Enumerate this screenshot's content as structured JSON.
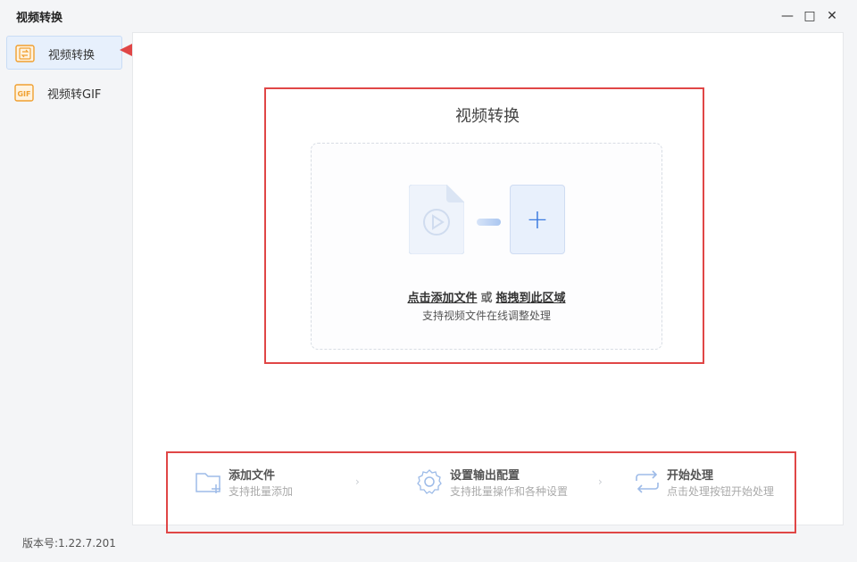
{
  "window": {
    "title": "视频转换",
    "minimize_label": "—",
    "maximize_label": "□",
    "close_label": "✕"
  },
  "sidebar": {
    "items": [
      {
        "label": "视频转换",
        "icon": "video-convert-icon",
        "active": true
      },
      {
        "label": "视频转GIF",
        "icon": "gif-icon",
        "active": false
      }
    ],
    "version": "版本号:1.22.7.201"
  },
  "main": {
    "title": "视频转换",
    "drop_zone": {
      "click_add": "点击添加文件",
      "or": "或",
      "drag_here": "拖拽到此区域",
      "subtitle": "支持视频文件在线调整处理",
      "plus_label": "+"
    },
    "steps": [
      {
        "title": "添加文件",
        "subtitle": "支持批量添加",
        "icon": "add-folder-icon"
      },
      {
        "title": "设置输出配置",
        "subtitle": "支持批量操作和各种设置",
        "icon": "gear-icon"
      },
      {
        "title": "开始处理",
        "subtitle": "点击处理按钮开始处理",
        "icon": "repeat-icon"
      }
    ],
    "step_separator": "›"
  },
  "colors": {
    "accent": "#3d7be0",
    "highlight_red": "#e04646",
    "icon_orange": "#f0a030"
  }
}
